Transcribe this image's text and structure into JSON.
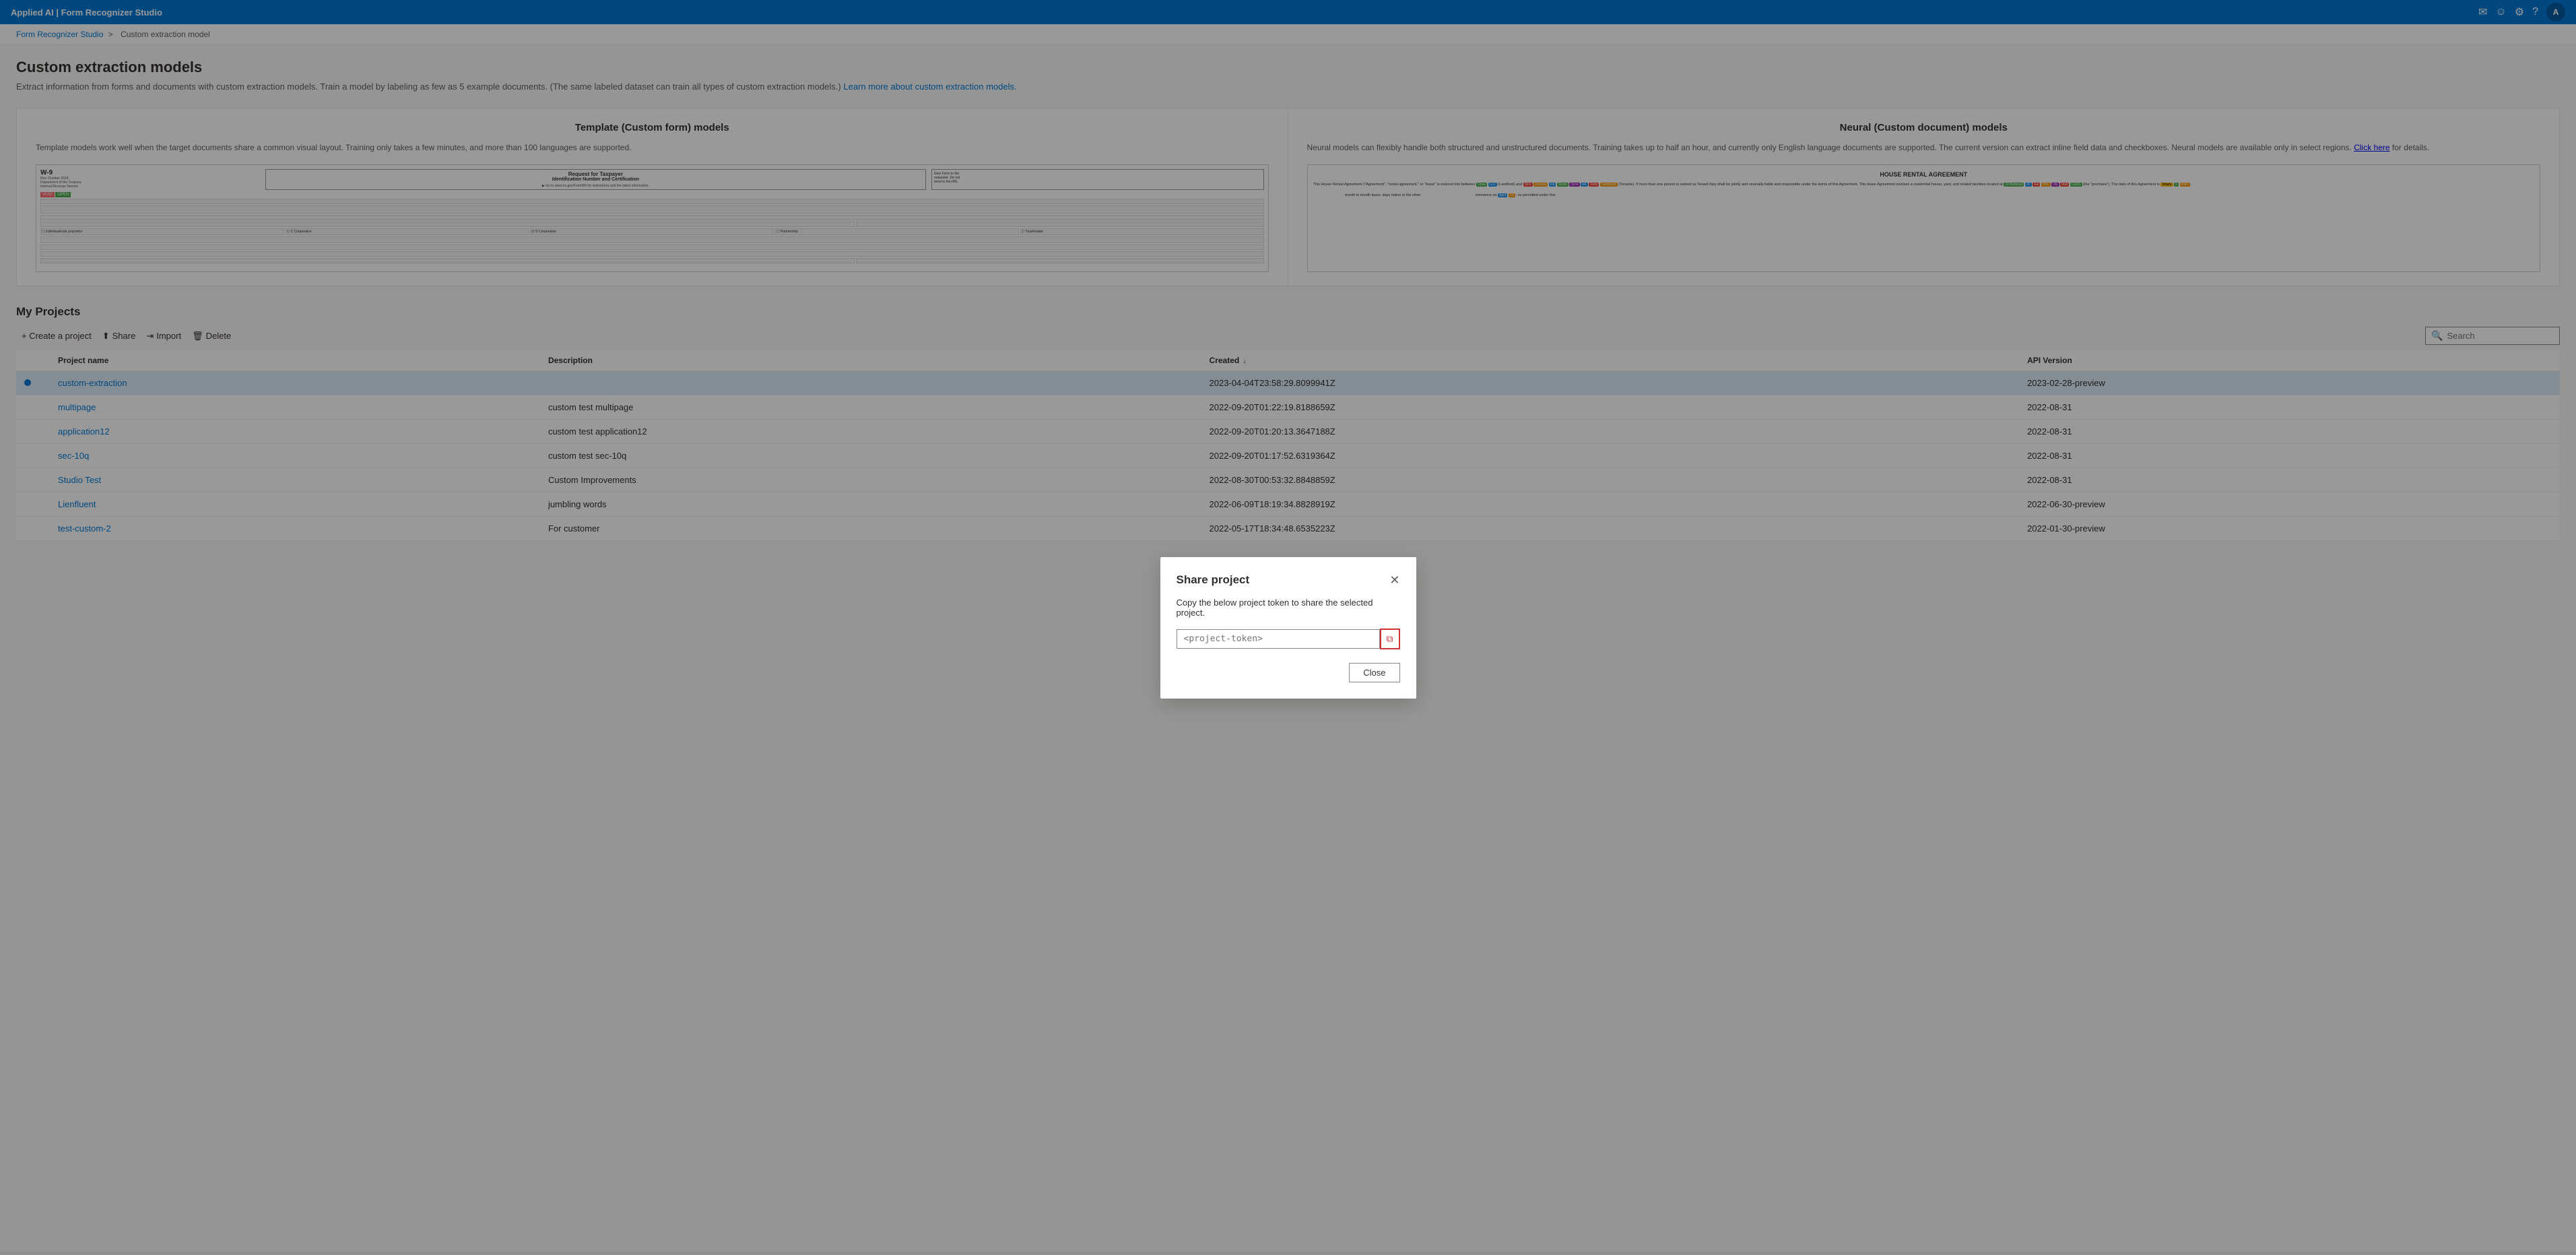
{
  "app": {
    "title": "Applied AI | Form Recognizer Studio",
    "avatar": "A"
  },
  "breadcrumb": {
    "parent": "Form Recognizer Studio",
    "separator": ">",
    "current": "Custom extraction model"
  },
  "page": {
    "title": "Custom extraction models",
    "subtitle": "Extract information from forms and documents with custom extraction models. Train a model by labeling as few as 5 example documents. (The same labeled dataset can train all types of custom extraction models.)",
    "subtitle_link": "Learn more about custom extraction models."
  },
  "template_card": {
    "title": "Template (Custom form) models",
    "description": "Template models work well when the target documents share a common visual layout. Training only takes a few minutes, and more than 100 languages are supported."
  },
  "neural_card": {
    "title": "Neural (Custom document) models",
    "description": "Neural models can flexibly handle both structured and unstructured documents. Training takes up to half an hour, and currently only English language documents are supported. The current version can extract inline field data and checkboxes. Neural models are available only in select regions.",
    "link_text": "Click here",
    "link_suffix": " for details."
  },
  "projects": {
    "section_title": "My Projects",
    "toolbar": {
      "create": "+ Create a project",
      "share": "Share",
      "import": "Import",
      "delete": "Delete"
    },
    "search_placeholder": "Search",
    "table": {
      "columns": [
        "Project name",
        "Description",
        "Created ↓",
        "API Version"
      ],
      "rows": [
        {
          "name": "custom-extraction",
          "description": "",
          "created": "2023-04-04T23:58:29.8099941Z",
          "api_version": "2023-02-28-preview",
          "selected": true,
          "status": true
        },
        {
          "name": "multipage",
          "description": "custom test multipage",
          "created": "2022-09-20T01:22:19.8188659Z",
          "api_version": "2022-08-31",
          "selected": false,
          "status": false
        },
        {
          "name": "application12",
          "description": "custom test application12",
          "created": "2022-09-20T01:20:13.3647188Z",
          "api_version": "2022-08-31",
          "selected": false,
          "status": false
        },
        {
          "name": "sec-10q",
          "description": "custom test sec-10q",
          "created": "2022-09-20T01:17:52.6319364Z",
          "api_version": "2022-08-31",
          "selected": false,
          "status": false
        },
        {
          "name": "Studio Test",
          "description": "Custom Improvements",
          "created": "2022-08-30T00:53:32.8848859Z",
          "api_version": "2022-08-31",
          "selected": false,
          "status": false
        },
        {
          "name": "Lienfluent",
          "description": "jumbling words",
          "created": "2022-06-09T18:19:34.8828919Z",
          "api_version": "2022-06-30-preview",
          "selected": false,
          "status": false
        },
        {
          "name": "test-custom-2",
          "description": "For customer",
          "created": "2022-05-17T18:34:48.6535223Z",
          "api_version": "2022-01-30-preview",
          "selected": false,
          "status": false
        }
      ]
    }
  },
  "modal": {
    "title": "Share project",
    "description": "Copy the below project token to share the selected project.",
    "token_placeholder": "<project-token>",
    "close_label": "Close"
  }
}
